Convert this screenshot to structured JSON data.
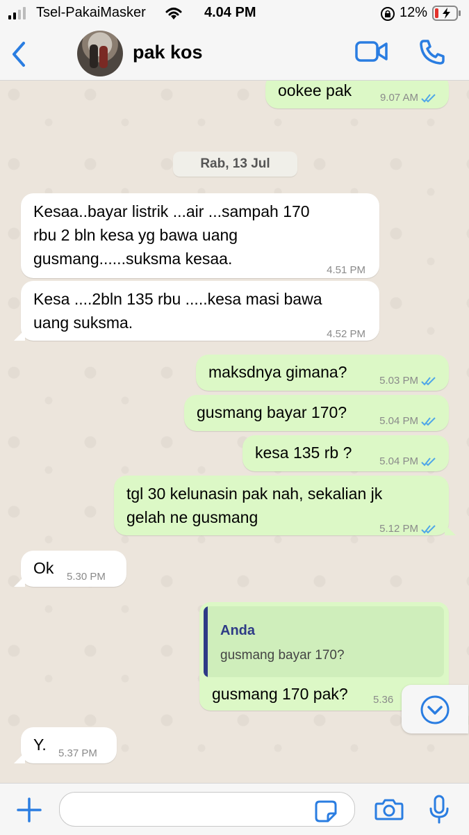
{
  "status_bar": {
    "carrier": "Tsel-PakaiMasker",
    "time": "4.04 PM",
    "battery": "12%"
  },
  "header": {
    "contact_name": "pak kos"
  },
  "date_divider": "Rab, 13 Jul",
  "messages": [
    {
      "direction": "out",
      "lines": [
        "ookee pak"
      ],
      "time": "9.07 AM",
      "read": true
    },
    {
      "direction": "in",
      "lines": [
        "Kesaa..bayar listrik ...air ...sampah 170",
        "rbu 2 bln kesa yg bawa uang",
        "gusmang......suksma kesaa."
      ],
      "time": "4.51 PM"
    },
    {
      "direction": "in",
      "lines": [
        "Kesa ....2bln 135 rbu .....kesa masi bawa",
        "uang suksma."
      ],
      "time": "4.52 PM"
    },
    {
      "direction": "out",
      "lines": [
        "maksdnya gimana?"
      ],
      "time": "5.03 PM",
      "read": true
    },
    {
      "direction": "out",
      "lines": [
        "gusmang bayar 170?"
      ],
      "time": "5.04 PM",
      "read": true
    },
    {
      "direction": "out",
      "lines": [
        "kesa 135 rb ?"
      ],
      "time": "5.04 PM",
      "read": true
    },
    {
      "direction": "out",
      "lines": [
        "tgl 30 kelunasin pak nah, sekalian jk",
        "gelah ne gusmang"
      ],
      "time": "5.12 PM",
      "read": true
    },
    {
      "direction": "in",
      "lines": [
        "Ok"
      ],
      "time": "5.30 PM"
    },
    {
      "direction": "out",
      "reply_to": {
        "author": "Anda",
        "text": "gusmang bayar 170?"
      },
      "lines": [
        "gusmang 170 pak?"
      ],
      "time": "5.36"
    },
    {
      "direction": "in",
      "lines": [
        "Y."
      ],
      "time": "5.37 PM"
    }
  ],
  "colors": {
    "accent": "#2a7de1",
    "outgoing_bubble": "#dcf8c6",
    "incoming_bubble": "#ffffff",
    "read_ticks": "#4fa6e8",
    "reply_author": "#2e3b86"
  },
  "icons": [
    "back-chevron-icon",
    "video-call-icon",
    "phone-call-icon",
    "plus-icon",
    "sticker-icon",
    "camera-icon",
    "microphone-icon",
    "chevron-down-icon"
  ],
  "input": {
    "placeholder": ""
  }
}
